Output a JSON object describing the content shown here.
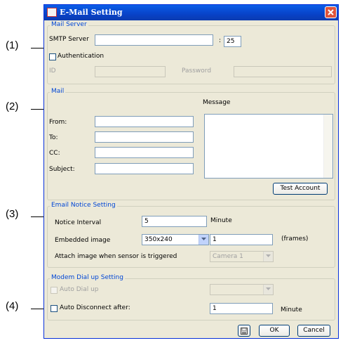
{
  "callouts": [
    "(1)",
    "(2)",
    "(3)",
    "(4)"
  ],
  "window": {
    "title": "E-Mail Setting"
  },
  "mail_server": {
    "group_label": "Mail Server",
    "smtp_label": "SMTP Server",
    "smtp_value": "",
    "port_sep": ":",
    "port_value": "25",
    "auth_label": "Authentication",
    "auth_checked": false,
    "id_label": "ID",
    "password_label": "Password"
  },
  "mail": {
    "group_label": "Mail",
    "message_label": "Message",
    "from_label": "From:",
    "to_label": "To:",
    "cc_label": "CC:",
    "subject_label": "Subject:",
    "test_account_label": "Test Account"
  },
  "email_notice": {
    "group_label": "Email Notice Setting",
    "interval_label": "Notice Interval",
    "interval_value": "5",
    "interval_unit": "Minute",
    "embedded_label": "Embedded image",
    "embedded_selected": "350x240",
    "frames_value": "1",
    "frames_unit": "(frames)",
    "attach_label": "Attach image when sensor is triggered",
    "attach_selected": "Camera 1"
  },
  "modem": {
    "group_label": "Modem Dial up Setting",
    "auto_dial_label": "Auto Dial up",
    "auto_disconnect_label": "Auto Disconnect after:",
    "disconnect_value": "1",
    "disconnect_unit": "Minute"
  },
  "buttons": {
    "ok": "OK",
    "cancel": "Cancel"
  },
  "icons": {
    "title": "app-icon",
    "close": "close-icon",
    "save": "save-disk-icon"
  },
  "colors": {
    "titlebar": "#0842c8",
    "group_label": "#0046d5",
    "dialog_bg": "#ece9d8"
  }
}
